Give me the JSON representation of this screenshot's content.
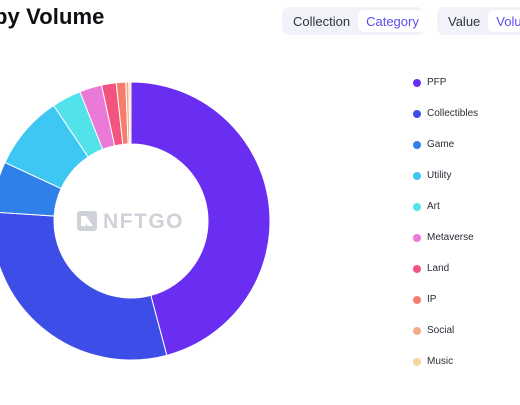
{
  "header": {
    "title": "by Volume"
  },
  "toggles": {
    "group_by": {
      "options": [
        "Collection",
        "Category"
      ],
      "selected": "Category"
    },
    "metric": {
      "options": [
        "Value",
        "Volu"
      ],
      "selected": "Volu"
    }
  },
  "watermark": {
    "text": "NFTGO"
  },
  "chart_data": {
    "type": "pie",
    "variant": "donut",
    "categories": [
      "PFP",
      "Collectibles",
      "Game",
      "Utility",
      "Art",
      "Metaverse",
      "Land",
      "IP",
      "Social",
      "Music"
    ],
    "values": [
      45.9,
      30.2,
      5.9,
      8.7,
      3.4,
      2.6,
      1.7,
      1.1,
      0.35,
      0.25
    ],
    "unit": "percent",
    "colors": [
      "#6a2ef2",
      "#3d4de8",
      "#2f80e8",
      "#3ec7f3",
      "#52e3ea",
      "#eb79d8",
      "#f2547f",
      "#f67c6c",
      "#f8aa8e",
      "#f8d4a1"
    ],
    "legend_position": "right"
  }
}
